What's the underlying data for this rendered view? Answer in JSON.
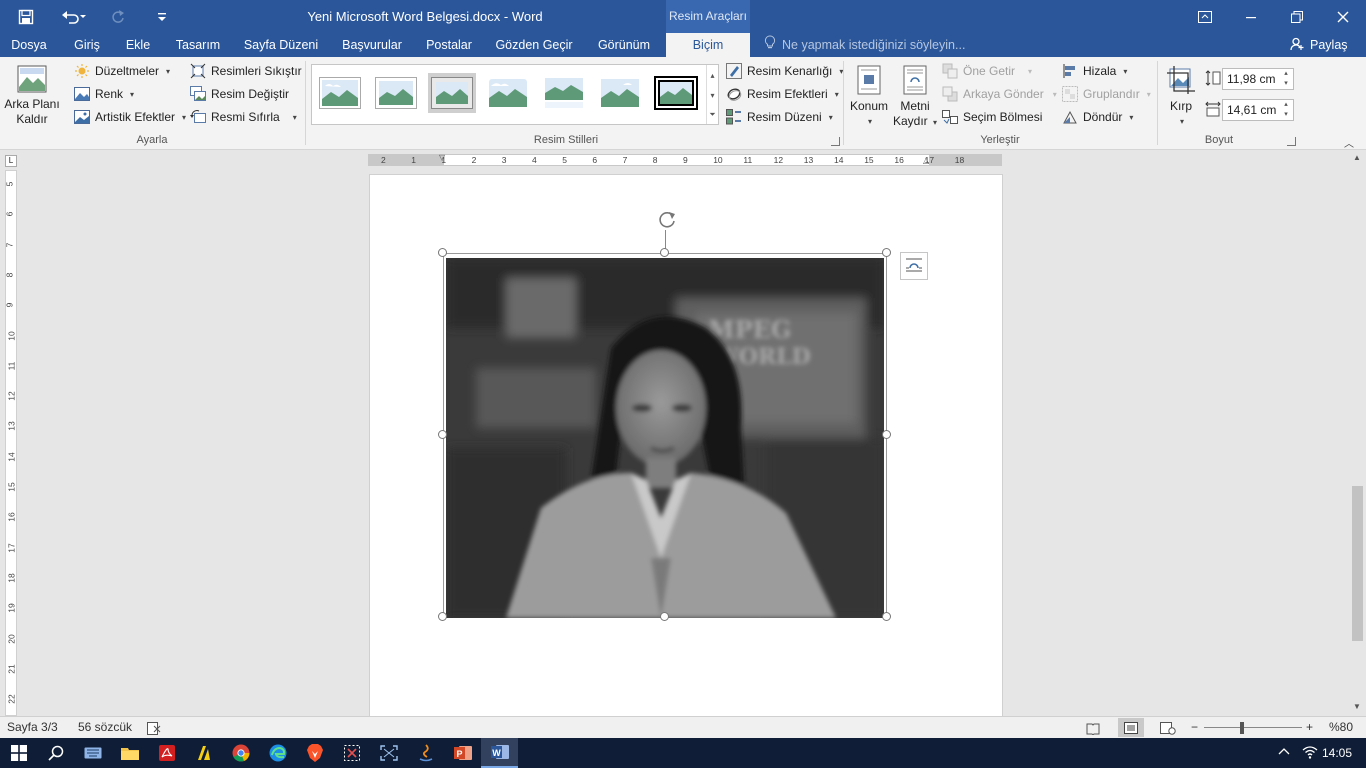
{
  "titlebar": {
    "doc_title": "Yeni Microsoft Word Belgesi.docx - Word",
    "context_tab_group": "Resim Araçları",
    "icons": [
      "save-icon",
      "undo-icon",
      "redo-icon",
      "customize-quick-access-icon",
      "ribbon-display-options-icon",
      "minimize-icon",
      "restore-icon",
      "close-icon"
    ]
  },
  "tabs": [
    {
      "label": "Dosya"
    },
    {
      "label": "Giriş"
    },
    {
      "label": "Ekle"
    },
    {
      "label": "Tasarım"
    },
    {
      "label": "Sayfa Düzeni"
    },
    {
      "label": "Başvurular"
    },
    {
      "label": "Postalar"
    },
    {
      "label": "Gözden Geçir"
    },
    {
      "label": "Görünüm"
    },
    {
      "label": "Biçim",
      "active": true
    }
  ],
  "tellme": {
    "placeholder": "Ne yapmak istediğinizi söyleyin..."
  },
  "share": {
    "label": "Paylaş"
  },
  "ribbon": {
    "ayarla": {
      "label": "Ayarla",
      "remove_bg": {
        "line1": "Arka Planı",
        "line2": "Kaldır"
      },
      "corrections": "Düzeltmeler",
      "color": "Renk",
      "artistic": "Artistik Efektler",
      "compress": "Resimleri Sıkıştır",
      "change": "Resim Değiştir",
      "reset": "Resmi Sıfırla"
    },
    "styles": {
      "label": "Resim Stilleri",
      "border": "Resim Kenarlığı",
      "effects": "Resim Efektleri",
      "layout": "Resim Düzeni",
      "thumb_count": 7,
      "selected_thumb": 7
    },
    "arrange": {
      "label": "Yerleştir",
      "position": "Konum",
      "wrap": {
        "line1": "Metni",
        "line2": "Kaydır"
      },
      "bring_forward": "Öne Getir",
      "send_backward": "Arkaya Gönder",
      "selection_pane": "Seçim Bölmesi",
      "align": "Hizala",
      "group": "Gruplandır",
      "rotate": "Döndür"
    },
    "size": {
      "label": "Boyut",
      "crop": "Kırp",
      "height": "11,98 cm",
      "width": "14,61 cm"
    }
  },
  "hruler": [
    "2",
    "1",
    "1",
    "2",
    "3",
    "4",
    "5",
    "6",
    "7",
    "8",
    "9",
    "10",
    "11",
    "12",
    "13",
    "14",
    "15",
    "16",
    "17",
    "18"
  ],
  "vruler": [
    "5",
    "6",
    "7",
    "8",
    "9",
    "10",
    "11",
    "12",
    "13",
    "14",
    "15",
    "16",
    "17",
    "18",
    "19",
    "20",
    "21",
    "22"
  ],
  "status": {
    "page": "Sayfa 3/3",
    "words": "56 sözcük",
    "zoom": "%80"
  },
  "taskbar": {
    "apps": [
      "start-icon",
      "search-icon",
      "keyboard-icon",
      "file-explorer-icon",
      "acrobat-icon",
      "norton-icon",
      "chrome-icon",
      "edge-icon",
      "brave-icon",
      "snipping-tool-icon",
      "capture-icon",
      "java-icon",
      "powerpoint-icon",
      "word-icon"
    ],
    "time": "14:05"
  }
}
